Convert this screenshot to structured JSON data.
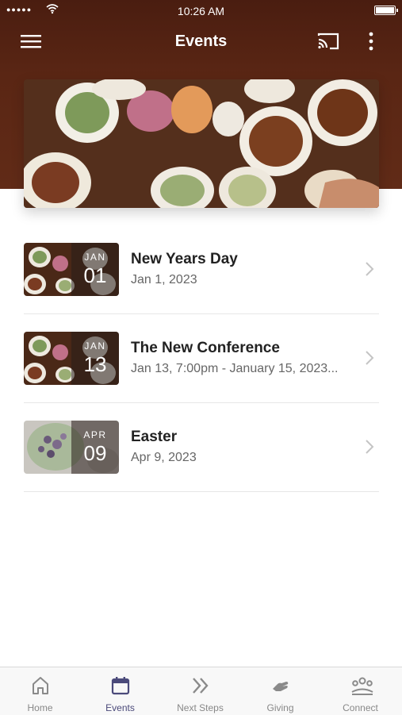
{
  "status": {
    "time": "10:26 AM",
    "signal": "●●●●●"
  },
  "nav": {
    "title": "Events"
  },
  "icons": {
    "menu": "hamburger-icon",
    "cast": "cast-icon",
    "more": "more-vertical-icon",
    "home": "home-icon",
    "events": "calendar-icon",
    "next_steps": "double-chevron-icon",
    "giving": "hand-icon",
    "connect": "people-icon"
  },
  "colors": {
    "header": "#5a2614",
    "accent_tab": "#4b4a7a"
  },
  "events": [
    {
      "month": "JAN",
      "day": "01",
      "title": "New Years Day",
      "subtitle": "Jan 1, 2023"
    },
    {
      "month": "JAN",
      "day": "13",
      "title": "The New Conference",
      "subtitle": "Jan 13, 7:00pm - January 15, 2023..."
    },
    {
      "month": "APR",
      "day": "09",
      "title": "Easter",
      "subtitle": "Apr 9, 2023"
    }
  ],
  "tabs": [
    {
      "label": "Home"
    },
    {
      "label": "Events"
    },
    {
      "label": "Next Steps"
    },
    {
      "label": "Giving"
    },
    {
      "label": "Connect"
    }
  ],
  "active_tab": "Events"
}
